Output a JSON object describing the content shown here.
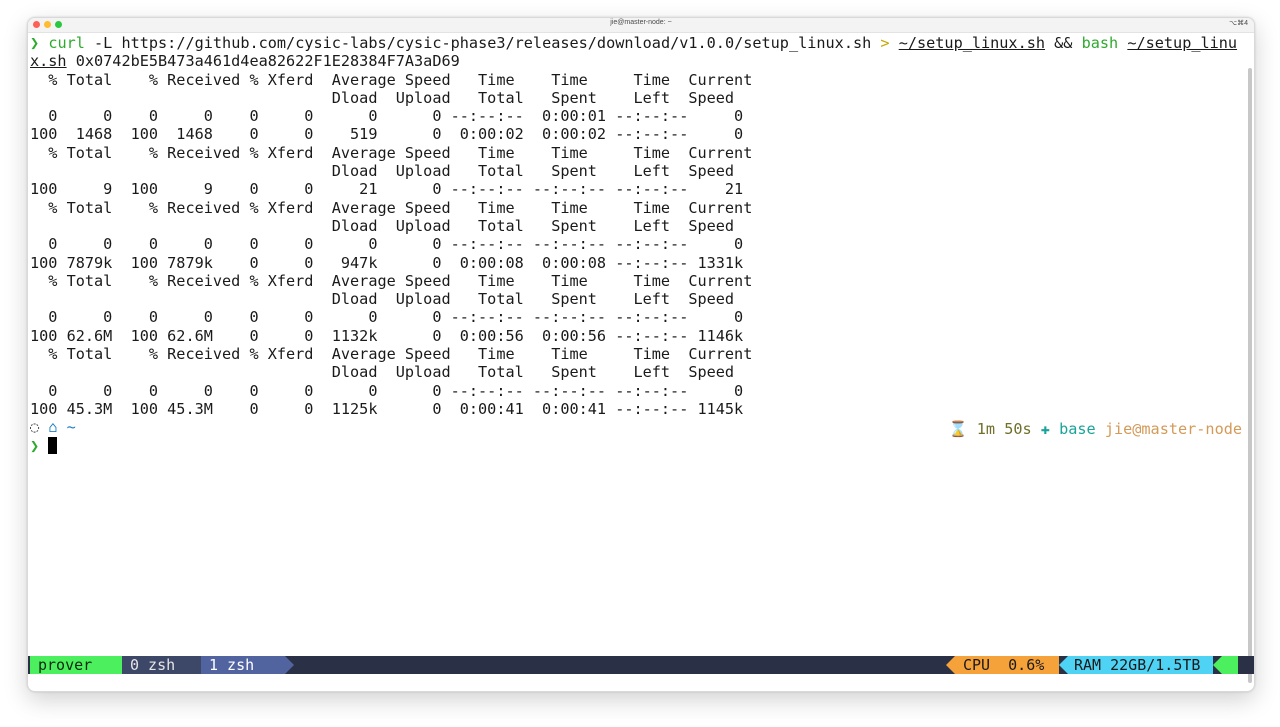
{
  "window": {
    "title": "jie@master-node: ~",
    "shortcut": "⌥⌘4"
  },
  "terminal": {
    "command": {
      "prompt": "❯",
      "part1": "curl",
      "part2": " -L https://github.com/cysic-labs/cysic-phase3/releases/download/v1.0.0/setup_linux.sh ",
      "redirect": ">",
      "target1": "~/setup_linux.sh",
      "and": " && ",
      "bash": "bash",
      "target2a": "~/setup_linu",
      "target2b": "x.sh",
      "arg": " 0x0742bE5B473a461d4ea82622F1E28384F7A3aD69"
    },
    "lines": [
      "  % Total    % Received % Xferd  Average Speed   Time    Time     Time  Current",
      "                                 Dload  Upload   Total   Spent    Left  Speed",
      "  0     0    0     0    0     0      0      0 --:--:--  0:00:01 --:--:--     0",
      "100  1468  100  1468    0     0    519      0  0:00:02  0:00:02 --:--:--     0",
      "  % Total    % Received % Xferd  Average Speed   Time    Time     Time  Current",
      "                                 Dload  Upload   Total   Spent    Left  Speed",
      "100     9  100     9    0     0     21      0 --:--:-- --:--:-- --:--:--    21",
      "  % Total    % Received % Xferd  Average Speed   Time    Time     Time  Current",
      "                                 Dload  Upload   Total   Spent    Left  Speed",
      "  0     0    0     0    0     0      0      0 --:--:-- --:--:-- --:--:--     0",
      "100 7879k  100 7879k    0     0   947k      0  0:00:08  0:00:08 --:--:-- 1331k",
      "  % Total    % Received % Xferd  Average Speed   Time    Time     Time  Current",
      "                                 Dload  Upload   Total   Spent    Left  Speed",
      "  0     0    0     0    0     0      0      0 --:--:-- --:--:-- --:--:--     0",
      "100 62.6M  100 62.6M    0     0  1132k      0  0:00:56  0:00:56 --:--:-- 1146k",
      "  % Total    % Received % Xferd  Average Speed   Time    Time     Time  Current",
      "                                 Dload  Upload   Total   Spent    Left  Speed",
      "  0     0    0     0    0     0      0      0 --:--:-- --:--:-- --:--:--     0",
      "100 45.3M  100 45.3M    0     0  1125k      0  0:00:41  0:00:41 --:--:-- 1145k"
    ],
    "status_prompt": {
      "os_icon": "◌",
      "home_icon": "⌂",
      "cwd": "~",
      "right_hourglass": "⌛",
      "duration": "1m 50s",
      "env_icon": "✚",
      "env": "base",
      "user_host": "jie@master-node"
    },
    "input_prompt": "❯"
  },
  "tmux": {
    "session": "prover",
    "windows": [
      {
        "label": "0 zsh"
      },
      {
        "label": "1 zsh"
      }
    ],
    "cpu": "CPU  0.6%",
    "ram": "RAM 22GB/1.5TB"
  },
  "colors": {
    "prompt_green": "#2eaa2e",
    "tmux_bg": "#2a3146",
    "session_green": "#4cf05e",
    "cpu_orange": "#f6a23b",
    "ram_cyan": "#4fd3f5"
  }
}
